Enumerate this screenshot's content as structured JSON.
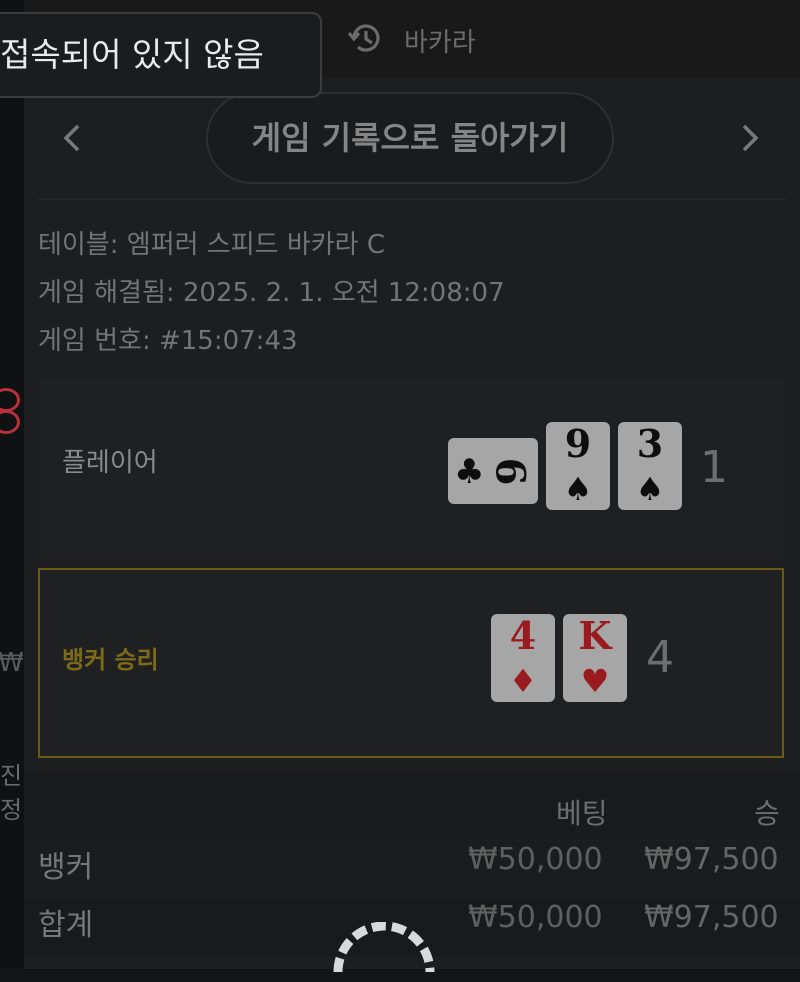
{
  "tooltip": {
    "text": "접속되어 있지 않음"
  },
  "header": {
    "title": "바카라",
    "history_icon": "history-icon"
  },
  "nav": {
    "back_label": "게임 기록으로 돌아가기",
    "prev_icon": "chevron-left-icon",
    "next_icon": "chevron-right-icon"
  },
  "meta": {
    "table": "테이블: 엠퍼러 스피드 바카라 C",
    "resolved": "게임 해결됨: 2025. 2. 1. 오전 12:08:07",
    "number": "게임 번호: #15:07:43"
  },
  "player": {
    "label": "플레이어",
    "cards": [
      {
        "rank": "6",
        "suit": "♣",
        "color": "black",
        "sideways": true
      },
      {
        "rank": "9",
        "suit": "♠",
        "color": "black"
      },
      {
        "rank": "3",
        "suit": "♠",
        "color": "black"
      }
    ],
    "total": "1"
  },
  "banker": {
    "label": "뱅커 승리",
    "cards": [
      {
        "rank": "4",
        "suit": "♦",
        "color": "red"
      },
      {
        "rank": "K",
        "suit": "♥",
        "color": "red"
      }
    ],
    "total": "4"
  },
  "table": {
    "headers": {
      "bet": "베팅",
      "win": "승"
    },
    "rows": [
      {
        "label": "뱅커",
        "bet": "₩50,000",
        "win": "₩97,500"
      },
      {
        "label": "합계",
        "bet": "₩50,000",
        "win": "₩97,500"
      }
    ]
  },
  "background": {
    "currency_symbol": "₩",
    "text1": "진",
    "text2": "정"
  },
  "colors": {
    "banker_accent": "#7c6a18",
    "red_suit": "#9a1b1e"
  }
}
